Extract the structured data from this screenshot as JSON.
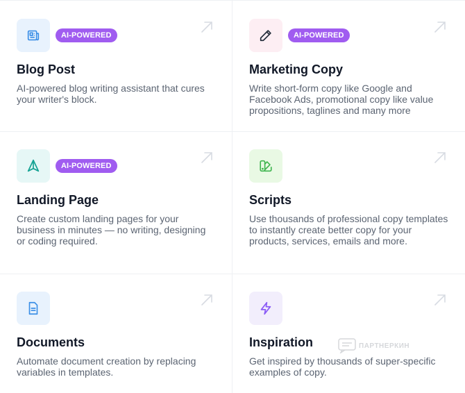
{
  "colors": {
    "badge_bg": "#a05cf0",
    "blog_icon_bg": "#e8f2fd",
    "blog_icon": "#3a8ee6",
    "marketing_icon_bg": "#fdeef3",
    "marketing_icon": "#1f2937",
    "landing_icon_bg": "#e6f7f6",
    "landing_icon": "#16a394",
    "scripts_icon_bg": "#e9f9e4",
    "scripts_icon": "#3fb54f",
    "documents_icon_bg": "#e8f2fd",
    "documents_icon": "#3a8ee6",
    "inspiration_icon_bg": "#f2eefc",
    "inspiration_icon": "#8b5cf6"
  },
  "cards": [
    {
      "icon": "newspaper-icon",
      "badge": "AI-POWERED",
      "title": "Blog Post",
      "description": "AI-powered blog writing assistant that cures your writer's block."
    },
    {
      "icon": "pencil-icon",
      "badge": "AI-POWERED",
      "title": "Marketing Copy",
      "description": "Write short-form copy like Google and Facebook Ads, promotional copy like value propositions, taglines and many more"
    },
    {
      "icon": "send-icon",
      "badge": "AI-POWERED",
      "title": "Landing Page",
      "description": "Create custom landing pages for your business in minutes — no writing, designing or coding required."
    },
    {
      "icon": "template-icon",
      "title": "Scripts",
      "description": "Use thousands of professional copy templates to instantly create better copy for your products, services, emails and more."
    },
    {
      "icon": "document-icon",
      "title": "Documents",
      "description": "Automate document creation by replacing variables in templates."
    },
    {
      "icon": "lightning-icon",
      "title": "Inspiration",
      "description": "Get inspired by thousands of super-specific examples of copy."
    }
  ],
  "watermark": "ПАРТНЕРКИН"
}
